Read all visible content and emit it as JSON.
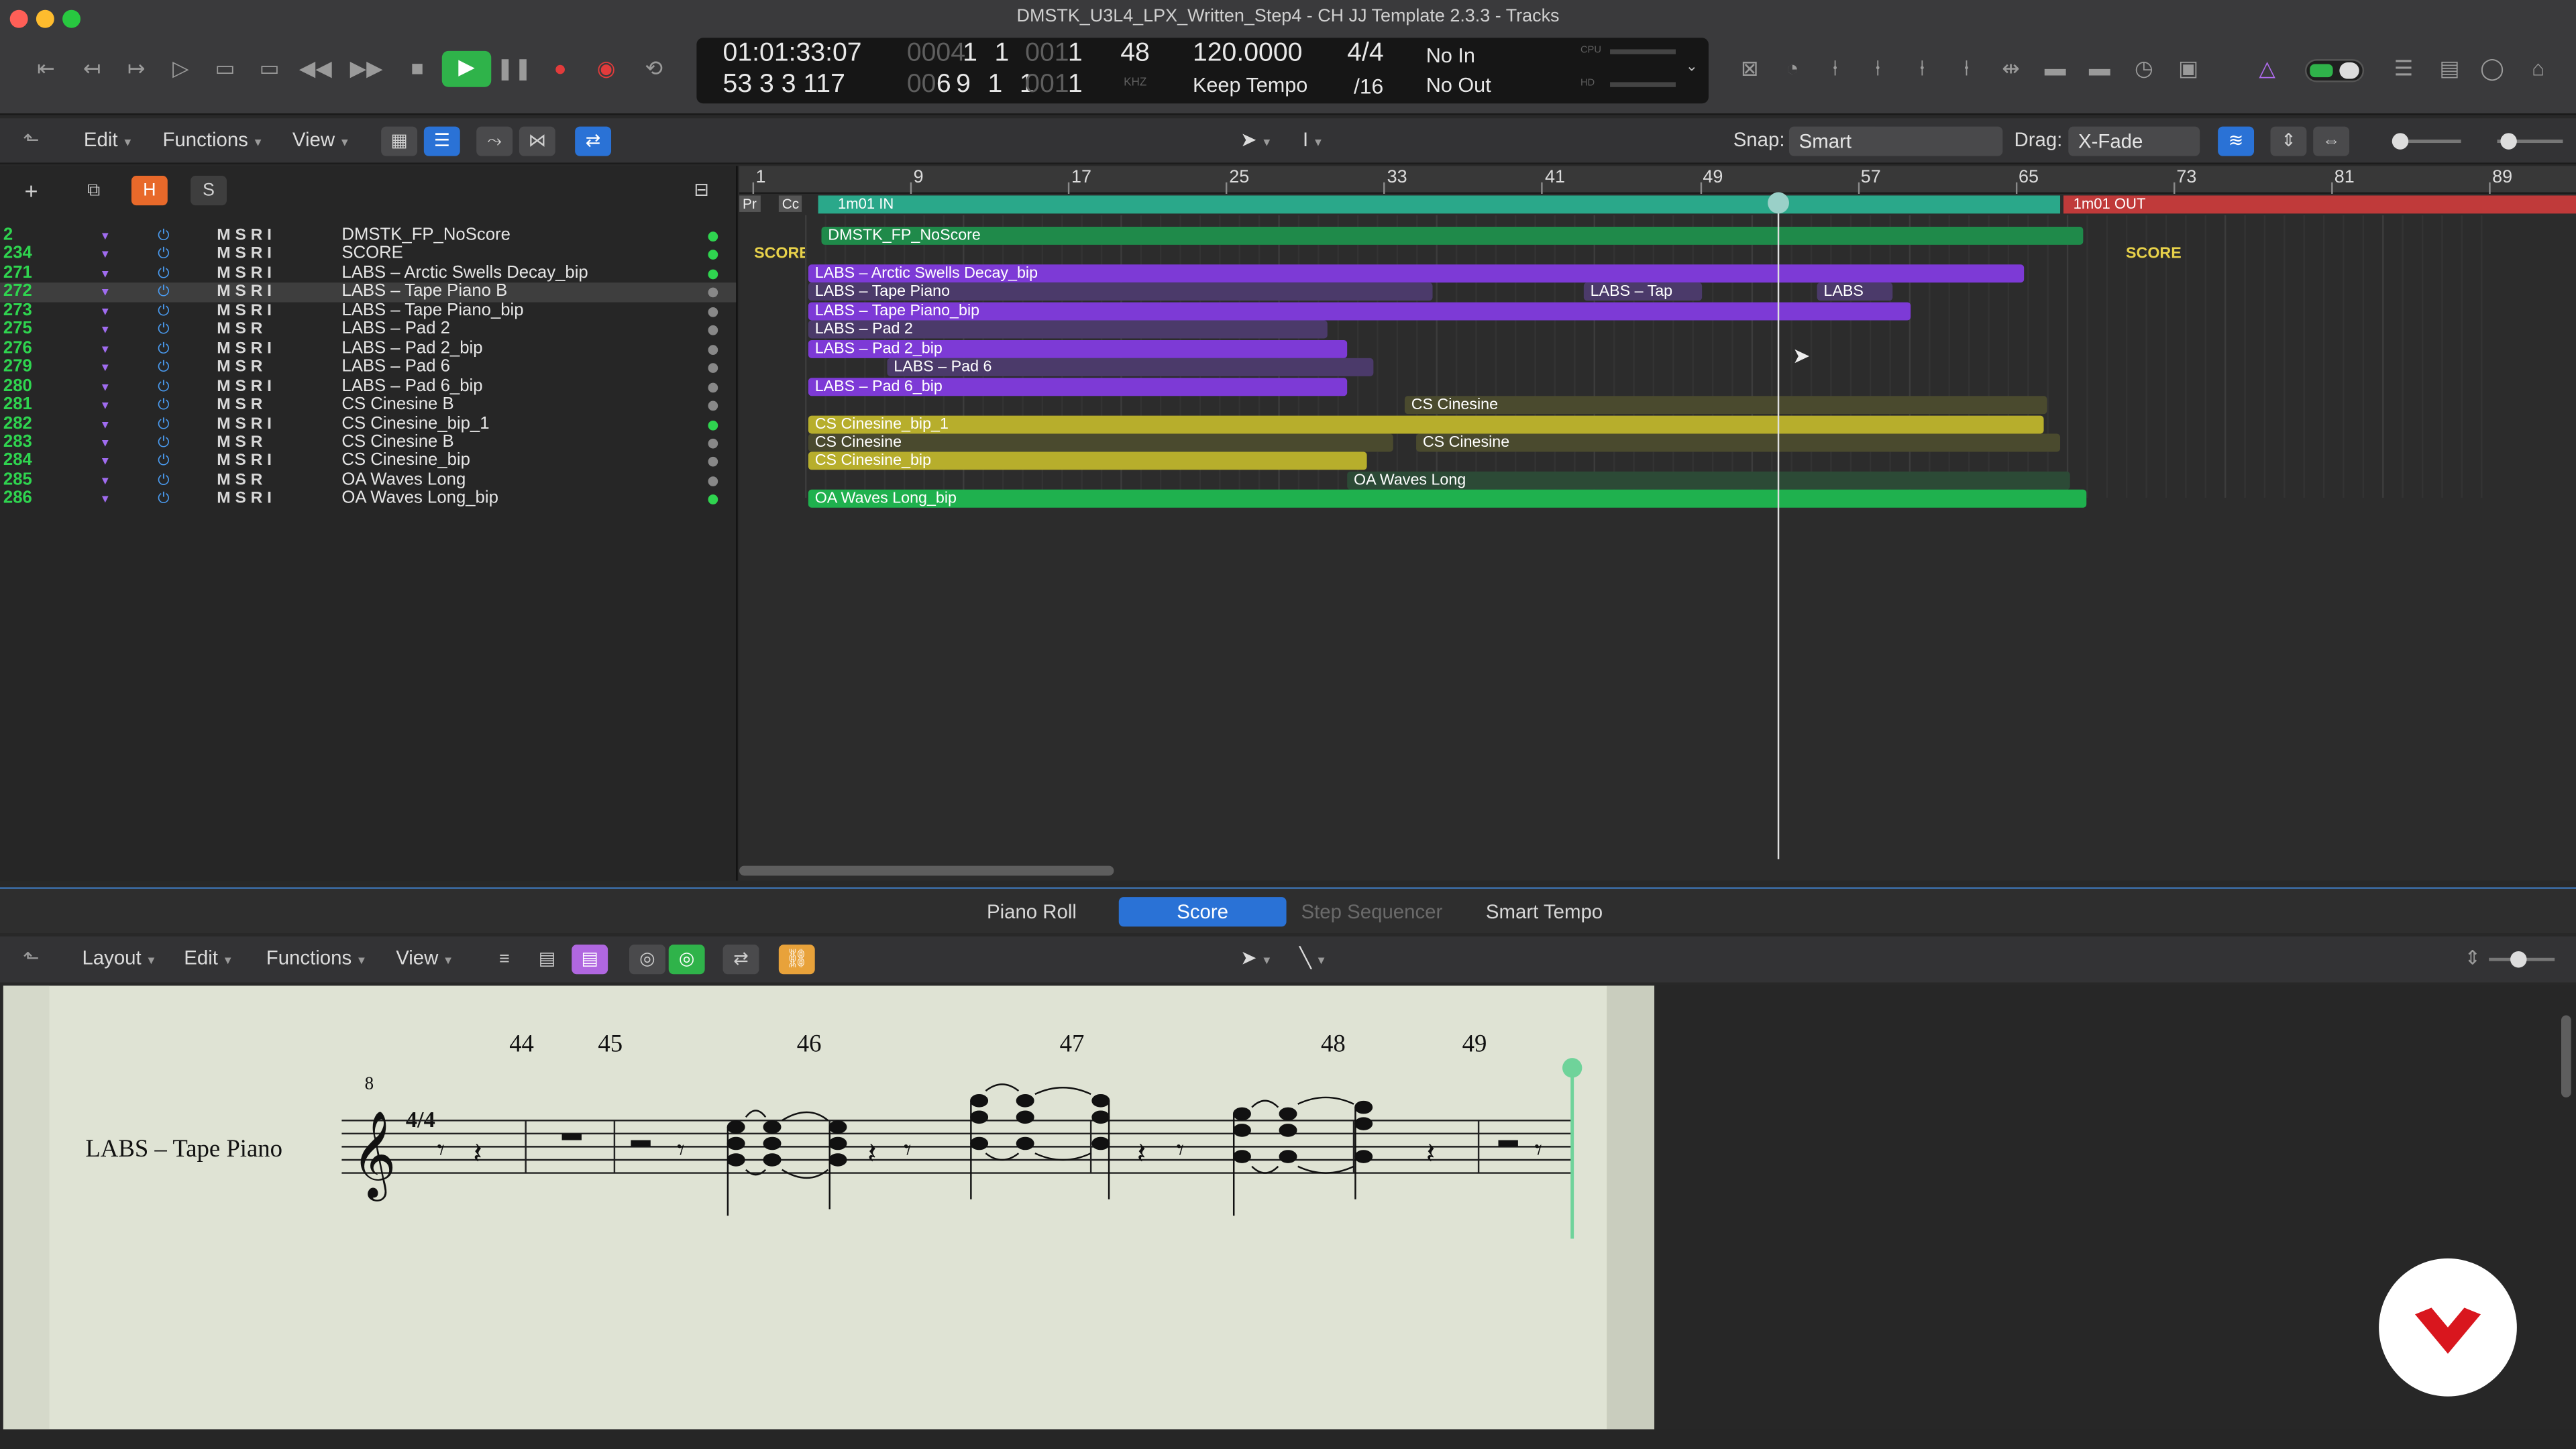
{
  "window": {
    "title": "DMSTK_U3L4_LPX_Written_Step4 - CH JJ Template 2.3.3 - Tracks"
  },
  "lcd": {
    "time": "01:01:33:07",
    "bars_top_dim": "0004",
    "bars_top": "1 1",
    "bars_top_tick_dim": "001",
    "bars_top_tick": "1",
    "position": "53 3 3 117",
    "bars_bottom_dim": "00",
    "bars_bottom": "69 1 1",
    "bars_bottom_tick_dim": "001",
    "bars_bottom_tick": "1",
    "sample_rate": "48",
    "sample_unit": "KHZ",
    "tempo": "120.0000",
    "tempo_mode": "Keep Tempo",
    "time_signature": "4/4",
    "division": "/16",
    "midi_in": "No In",
    "midi_out": "No Out",
    "cpu_label": "CPU",
    "hd_label": "HD"
  },
  "tracks_toolbar": {
    "edit": "Edit",
    "functions": "Functions",
    "view": "View",
    "snap_label": "Snap:",
    "snap_value": "Smart",
    "drag_label": "Drag:",
    "drag_value": "X-Fade"
  },
  "track_header_buttons": {
    "h": "H",
    "s": "S"
  },
  "tracks": [
    {
      "num": "2",
      "name": "DMSTK_FP_NoScore",
      "msr": "M  S  R  I",
      "dot": "#2fd44f"
    },
    {
      "num": "234",
      "name": "SCORE",
      "msr": "M  S  R  I",
      "dot": "#2fd44f"
    },
    {
      "num": "271",
      "name": "LABS – Arctic Swells Decay_bip",
      "msr": "M  S  R  I",
      "dot": "#2fd44f"
    },
    {
      "num": "272",
      "name": "LABS – Tape Piano  B",
      "msr": "M  S  R  I",
      "dot": "#888888"
    },
    {
      "num": "273",
      "name": "LABS – Tape Piano_bip",
      "msr": "M  S  R  I",
      "dot": "#888888"
    },
    {
      "num": "275",
      "name": "LABS – Pad 2",
      "msr": "M  S  R",
      "dot": "#888888"
    },
    {
      "num": "276",
      "name": "LABS – Pad 2_bip",
      "msr": "M  S  R  I",
      "dot": "#888888"
    },
    {
      "num": "279",
      "name": "LABS – Pad 6",
      "msr": "M  S  R",
      "dot": "#888888"
    },
    {
      "num": "280",
      "name": "LABS – Pad 6_bip",
      "msr": "M  S  R  I",
      "dot": "#888888"
    },
    {
      "num": "281",
      "name": "CS Cinesine  B",
      "msr": "M  S  R",
      "dot": "#888888"
    },
    {
      "num": "282",
      "name": "CS Cinesine_bip_1",
      "msr": "M  S  R  I",
      "dot": "#2fd44f"
    },
    {
      "num": "283",
      "name": "CS Cinesine  B",
      "msr": "M  S  R",
      "dot": "#888888"
    },
    {
      "num": "284",
      "name": "CS Cinesine_bip",
      "msr": "M  S  R  I",
      "dot": "#888888"
    },
    {
      "num": "285",
      "name": "OA Waves Long",
      "msr": "M  S  R",
      "dot": "#888888"
    },
    {
      "num": "286",
      "name": "OA Waves Long_bip",
      "msr": "M  S  R  I",
      "dot": "#2fd44f"
    }
  ],
  "ruler": {
    "bars": [
      "1",
      "9",
      "17",
      "25",
      "33",
      "41",
      "49",
      "57",
      "65",
      "73",
      "81",
      "89"
    ],
    "in_marker": "1m01 IN",
    "out_marker": "1m01 OUT",
    "pr_label": "Pr",
    "cc_label": "Cc"
  },
  "regions": [
    {
      "row": 0,
      "start": 500,
      "end": 1268,
      "color": "#1f8a4a",
      "label": "DMSTK_FP_NoScore"
    },
    {
      "row": 1,
      "start": 455,
      "end": 490,
      "color": "transparent",
      "label": "SCORE",
      "text": "#e8d24a"
    },
    {
      "row": 1,
      "start": 1290,
      "end": 1330,
      "color": "transparent",
      "label": "SCORE",
      "text": "#e8d24a"
    },
    {
      "row": 2,
      "start": 492,
      "end": 1232,
      "color": "#7d3ad6",
      "label": "LABS – Arctic Swells Decay_bip"
    },
    {
      "row": 3,
      "start": 492,
      "end": 872,
      "color": "#4b3a6a",
      "label": "LABS – Tape Piano"
    },
    {
      "row": 3,
      "start": 964,
      "end": 1036,
      "color": "#4b3a6a",
      "label": "LABS – Tap"
    },
    {
      "row": 3,
      "start": 1106,
      "end": 1152,
      "color": "#4b3a6a",
      "label": "LABS"
    },
    {
      "row": 4,
      "start": 492,
      "end": 1163,
      "color": "#7d3ad6",
      "label": "LABS – Tape Piano_bip"
    },
    {
      "row": 5,
      "start": 492,
      "end": 808,
      "color": "#4b3a6a",
      "label": "LABS – Pad 2"
    },
    {
      "row": 6,
      "start": 492,
      "end": 820,
      "color": "#7d3ad6",
      "label": "LABS – Pad 2_bip"
    },
    {
      "row": 7,
      "start": 540,
      "end": 836,
      "color": "#4b3a6a",
      "label": "LABS – Pad 6"
    },
    {
      "row": 8,
      "start": 492,
      "end": 820,
      "color": "#7d3ad6",
      "label": "LABS – Pad 6_bip"
    },
    {
      "row": 9,
      "start": 855,
      "end": 1246,
      "color": "#4a4a2e",
      "label": "CS Cinesine"
    },
    {
      "row": 10,
      "start": 492,
      "end": 1244,
      "color": "#b7ae2c",
      "label": "CS Cinesine_bip_1"
    },
    {
      "row": 11,
      "start": 492,
      "end": 848,
      "color": "#4a4a2e",
      "label": "CS Cinesine"
    },
    {
      "row": 11,
      "start": 862,
      "end": 1254,
      "color": "#4a4a2e",
      "label": "CS Cinesine"
    },
    {
      "row": 12,
      "start": 492,
      "end": 832,
      "color": "#b7ae2c",
      "label": "CS Cinesine_bip"
    },
    {
      "row": 13,
      "start": 820,
      "end": 1260,
      "color": "#2c4a36",
      "label": "OA Waves Long"
    },
    {
      "row": 14,
      "start": 492,
      "end": 1270,
      "color": "#1fb14e",
      "label": "OA Waves Long_bip"
    }
  ],
  "editor_tabs": {
    "piano_roll": "Piano Roll",
    "score": "Score",
    "step_sequencer": "Step Sequencer",
    "smart_tempo": "Smart Tempo"
  },
  "editor_toolbar": {
    "layout": "Layout",
    "edit": "Edit",
    "functions": "Functions",
    "view": "View"
  },
  "score": {
    "staff_name": "LABS – Tape Piano",
    "clef_octave": "8",
    "time_signature": "4/4",
    "bars": [
      "44",
      "45",
      "46",
      "47",
      "48",
      "49"
    ]
  },
  "colors": {
    "play_green": "#2fb34a",
    "record_red": "#e23b3b",
    "active_blue": "#2a72d6",
    "track_number_green": "#2fd44f",
    "region_purple": "#7d3ad6",
    "region_yellow": "#b7ae2c",
    "region_green": "#1fb14e",
    "cycle_green": "#2aa88a",
    "out_red": "#c03a3a",
    "score_paper": "#dfe3d4"
  }
}
